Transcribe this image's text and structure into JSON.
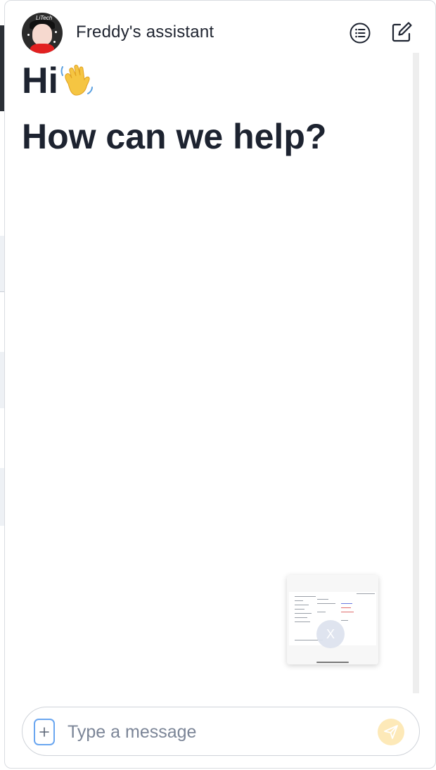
{
  "header": {
    "title": "Freddy's assistant",
    "avatar_icon": "user-avatar",
    "menu_icon": "list-icon",
    "compose_icon": "compose-icon",
    "avatar_tag": "LiTech"
  },
  "main": {
    "greeting": "Hi",
    "greeting_icon": "waving-hand-icon",
    "subheading": "How can we help?"
  },
  "attachment": {
    "type": "document-thumbnail",
    "remove_label": "X"
  },
  "composer": {
    "attach_icon": "plus-icon",
    "placeholder": "Type a message",
    "send_icon": "send-icon"
  },
  "colors": {
    "text": "#1d2330",
    "send_button": "#fde9b8",
    "attach_border": "#6aa6f0",
    "scroll_track": "#eeeeee"
  }
}
